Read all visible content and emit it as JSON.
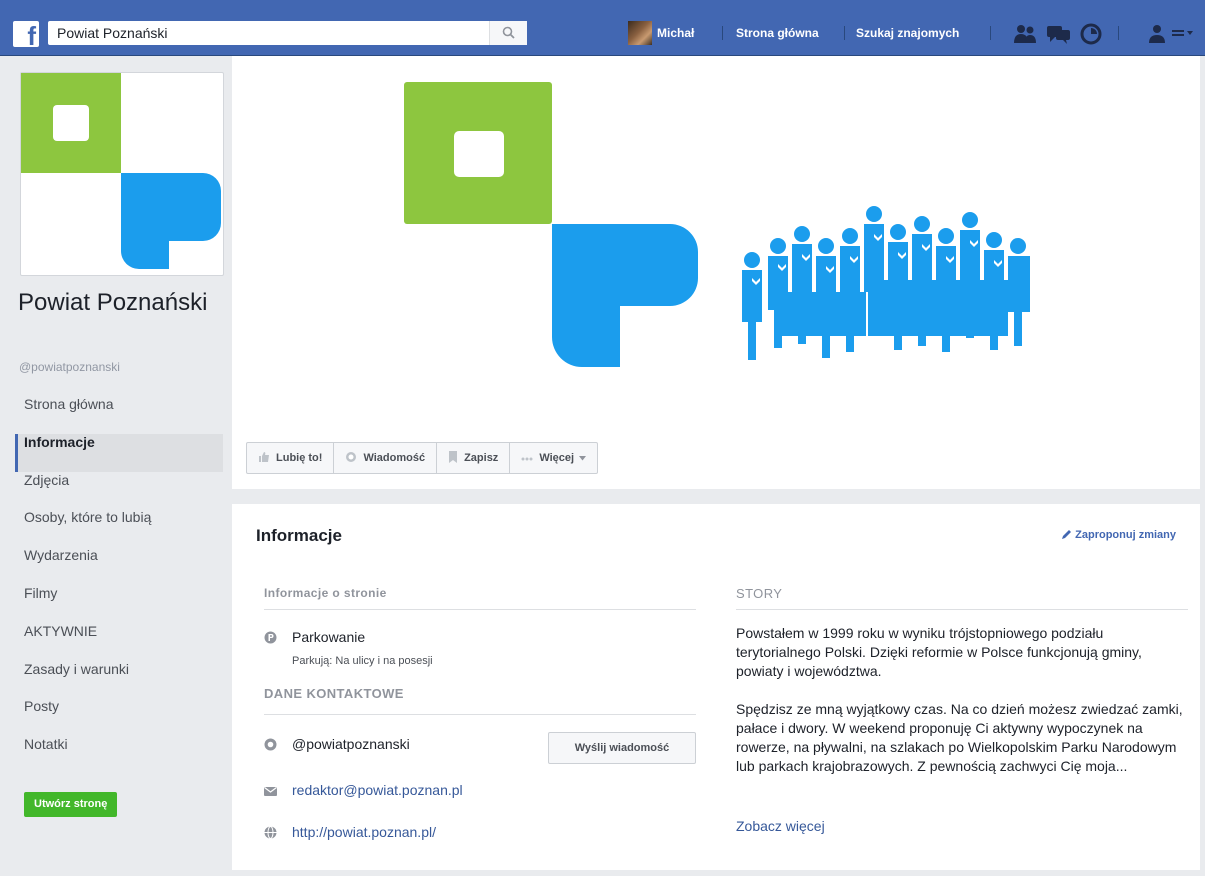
{
  "topbar": {
    "search_value": "Powiat Poznański",
    "user_name": "Michał",
    "nav_home": "Strona główna",
    "nav_find_friends": "Szukaj znajomych",
    "brand_color": "#4267b2",
    "icons": [
      "friend-requests-icon",
      "messages-icon",
      "notifications-icon",
      "help-icon",
      "account-menu-icon"
    ]
  },
  "page": {
    "name": "Powiat Poznański",
    "handle": "@powiatpoznanski"
  },
  "sidebar": {
    "items": [
      {
        "label": "Strona główna"
      },
      {
        "label": "Informacje"
      },
      {
        "label": "Zdjęcia"
      },
      {
        "label": "Osoby, które to lubią"
      },
      {
        "label": "Wydarzenia"
      },
      {
        "label": "Filmy"
      },
      {
        "label": "AKTYWNIE"
      },
      {
        "label": "Zasady i warunki"
      },
      {
        "label": "Posty"
      },
      {
        "label": "Notatki"
      }
    ],
    "active_label": "Informacje",
    "create_page_label": "Utwórz stronę"
  },
  "cover": {
    "logo_colors": {
      "green": "#8dc63f",
      "blue": "#1b9ded"
    },
    "actions": {
      "like": "Lubię to!",
      "message": "Wiadomość",
      "save": "Zapisz",
      "more": "Więcej"
    }
  },
  "info": {
    "title": "Informacje",
    "suggest_edits": "Zaproponuj zmiany",
    "page_info_heading": "Informacje o stronie",
    "parking_label": "Parkowanie",
    "parking_value": "Parkują: Na ulicy i na posesji",
    "contact_heading": "DANE KONTAKTOWE",
    "messenger_handle": "@powiatpoznanski",
    "send_message": "Wyślij wiadomość",
    "email": "redaktor@powiat.poznan.pl",
    "website": "http://powiat.poznan.pl/",
    "story_heading": "STORY",
    "story_p1": "Powstałem w 1999 roku w wyniku trójstopniowego podziału terytorialnego Polski. Dzięki reformie w Polsce funkcjonują gminy, powiaty i województwa.",
    "story_p2": "Spędzisz ze mną wyjątkowy czas. Na co dzień możesz zwiedzać zamki, pałace i dwory. W weekend proponuję Ci aktywny wypoczynek na rowerze, na pływalni, na szlakach po Wielkopolskim Parku Narodowym lub parkach krajobrazowych. Z pewnością zachwyci Cię moja...",
    "see_more": "Zobacz więcej"
  }
}
